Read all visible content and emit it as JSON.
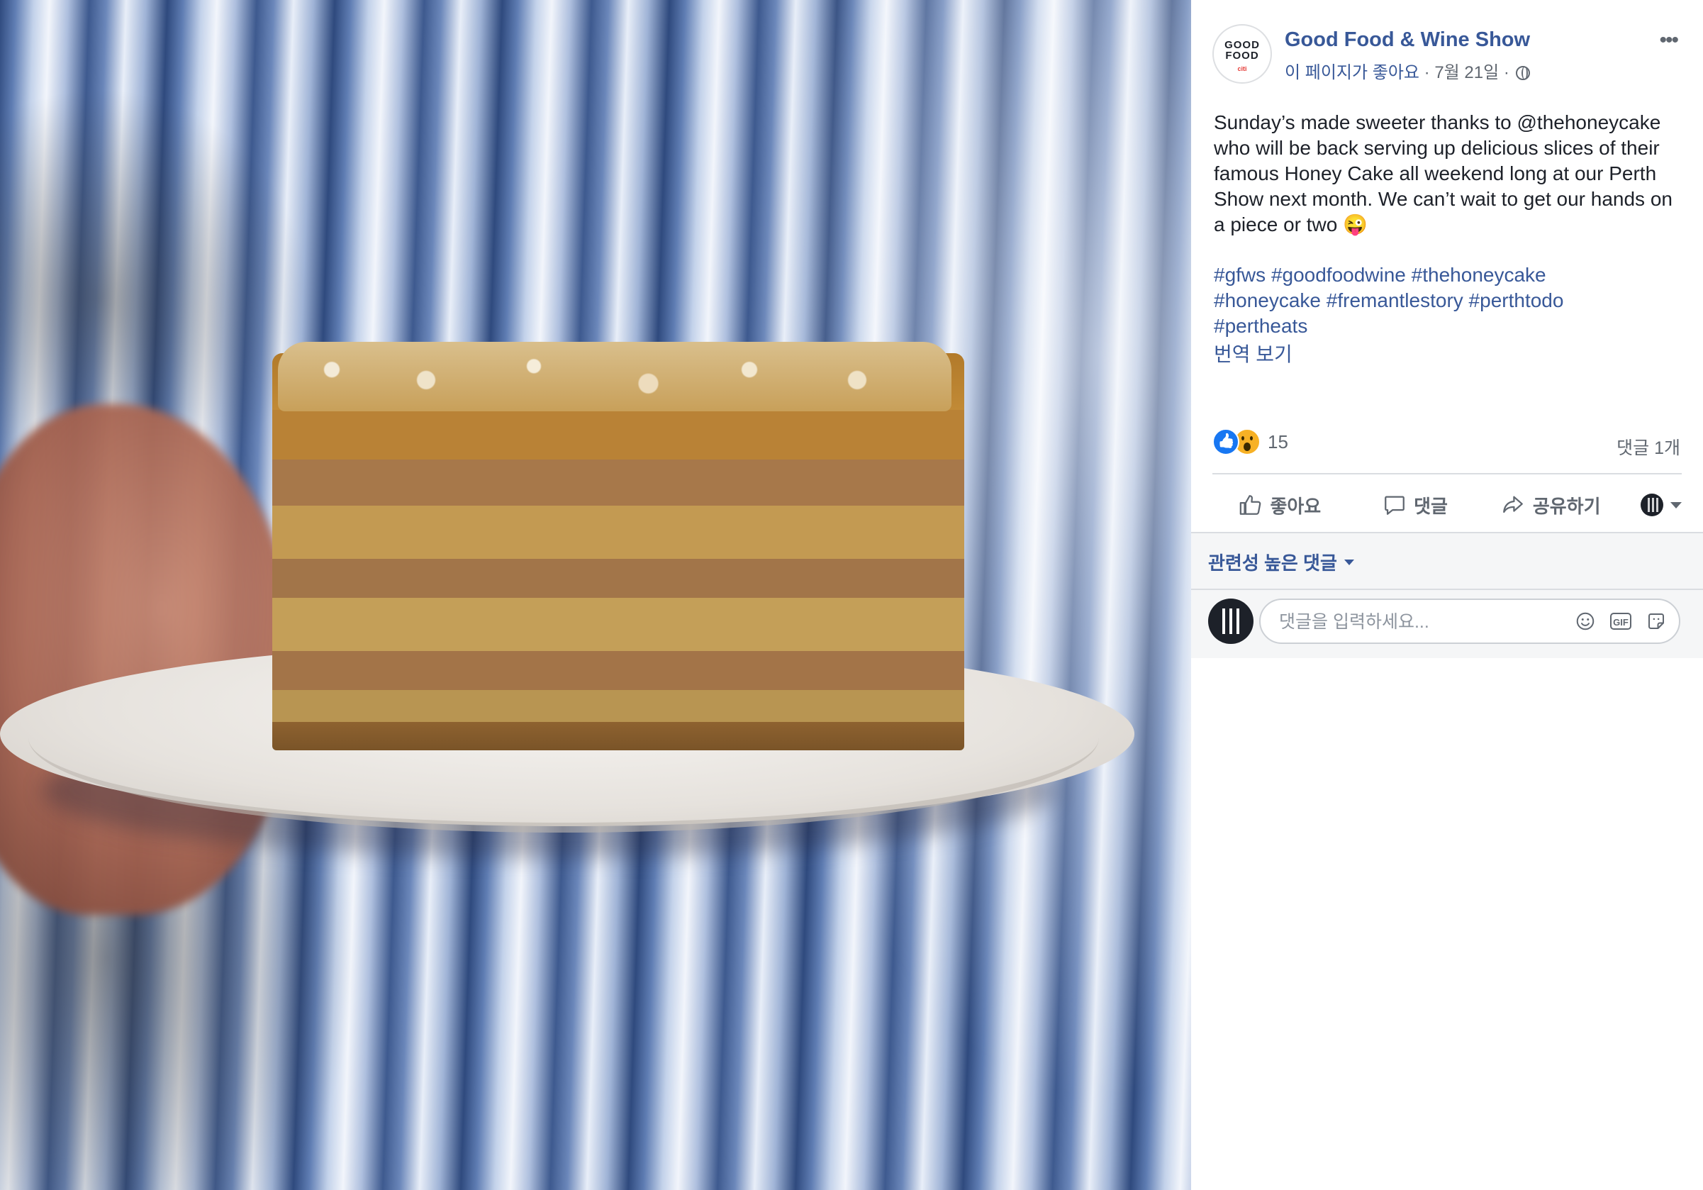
{
  "page": {
    "name": "Good Food & Wine Show",
    "liked_label": "이 페이지가 좋아요",
    "separator": "·",
    "date": "7월 21일",
    "avatar_line1": "GOOD",
    "avatar_line2": "FOOD",
    "avatar_line3": "citi"
  },
  "post": {
    "text": "Sunday’s made sweeter thanks to @thehoneycake who will be back serving up delicious slices of their famous Honey Cake all weekend long at our Perth Show next month. We can’t wait to get our hands on a piece or two 😜",
    "hashtags": [
      "#gfws",
      "#goodfoodwine",
      "#thehoneycake",
      "#honeycake",
      "#fremantlestory",
      "#perthtodo",
      "#pertheats"
    ],
    "translate_link": "번역 보기"
  },
  "reactions": {
    "count": "15",
    "types": [
      "like-icon",
      "wow-icon"
    ],
    "comment_count": "댓글 1개"
  },
  "actions": {
    "like": "좋아요",
    "comment": "댓글",
    "share": "공유하기"
  },
  "comments": {
    "sort_label": "관련성 높은 댓글",
    "input_placeholder": "댓글을 입력하세요..."
  },
  "colors": {
    "link": "#385898",
    "secondary_text": "#606770",
    "like_blue": "#1877f2",
    "wow_yellow": "#f7b125"
  }
}
